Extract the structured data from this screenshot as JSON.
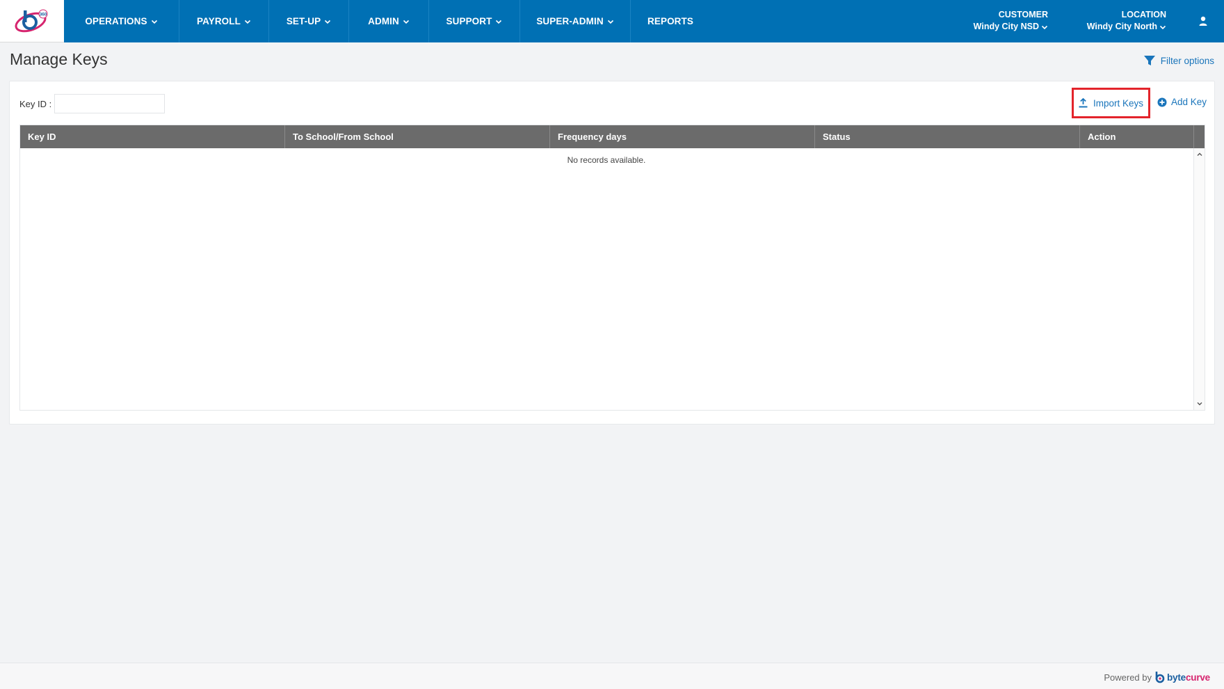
{
  "nav": {
    "items": [
      {
        "label": "OPERATIONS",
        "dropdown": true
      },
      {
        "label": "PAYROLL",
        "dropdown": true
      },
      {
        "label": "SET-UP",
        "dropdown": true
      },
      {
        "label": "ADMIN",
        "dropdown": true
      },
      {
        "label": "SUPPORT",
        "dropdown": true
      },
      {
        "label": "SUPER-ADMIN",
        "dropdown": true
      },
      {
        "label": "REPORTS",
        "dropdown": false
      }
    ],
    "customer": {
      "label": "CUSTOMER",
      "value": "Windy City NSD"
    },
    "location": {
      "label": "LOCATION",
      "value": "Windy City North"
    }
  },
  "page": {
    "title": "Manage Keys",
    "filter_label": "Filter options"
  },
  "search": {
    "key_id_label": "Key ID :",
    "key_id_value": "",
    "key_id_placeholder": ""
  },
  "actions": {
    "import_label": "Import Keys",
    "add_label": "Add Key"
  },
  "grid": {
    "columns": [
      "Key ID",
      "To School/From School",
      "Frequency days",
      "Status",
      "Action"
    ],
    "rows": [],
    "empty_text": "No records available."
  },
  "footer": {
    "powered_by": "Powered by",
    "brand_a": "byte",
    "brand_b": "curve"
  },
  "colors": {
    "nav_bg": "#0070b4",
    "link": "#1a75bb",
    "grid_header": "#6b6b6b",
    "highlight_border": "#e3242b"
  }
}
